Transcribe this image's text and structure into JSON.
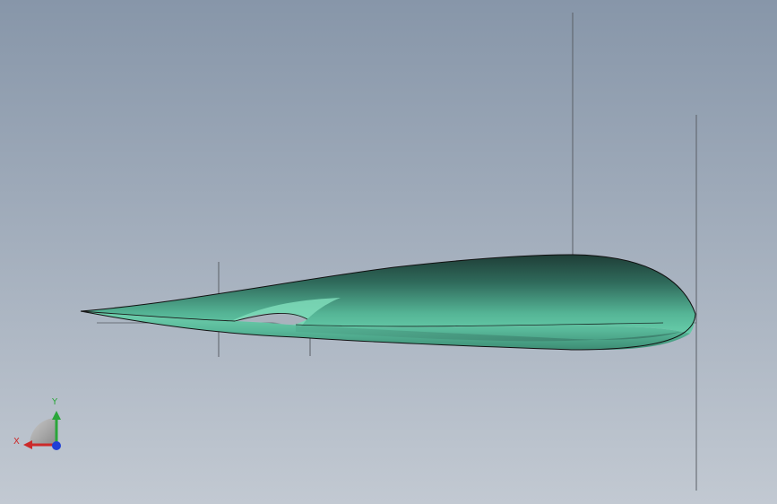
{
  "viewport": {
    "background_top": "#8796a9",
    "background_bottom": "#c2c9d2",
    "model_color": "#62c9a8",
    "model_shadow_color": "#1e3d36",
    "edge_color": "#111111",
    "reference_line_color": "#5a5f66"
  },
  "triad": {
    "x_label": "X",
    "y_label": "Y",
    "x_color": "#cc2a2a",
    "y_color": "#2aa63a",
    "z_color": "#1f3fd6",
    "plane_color": "#a6a6a6"
  }
}
